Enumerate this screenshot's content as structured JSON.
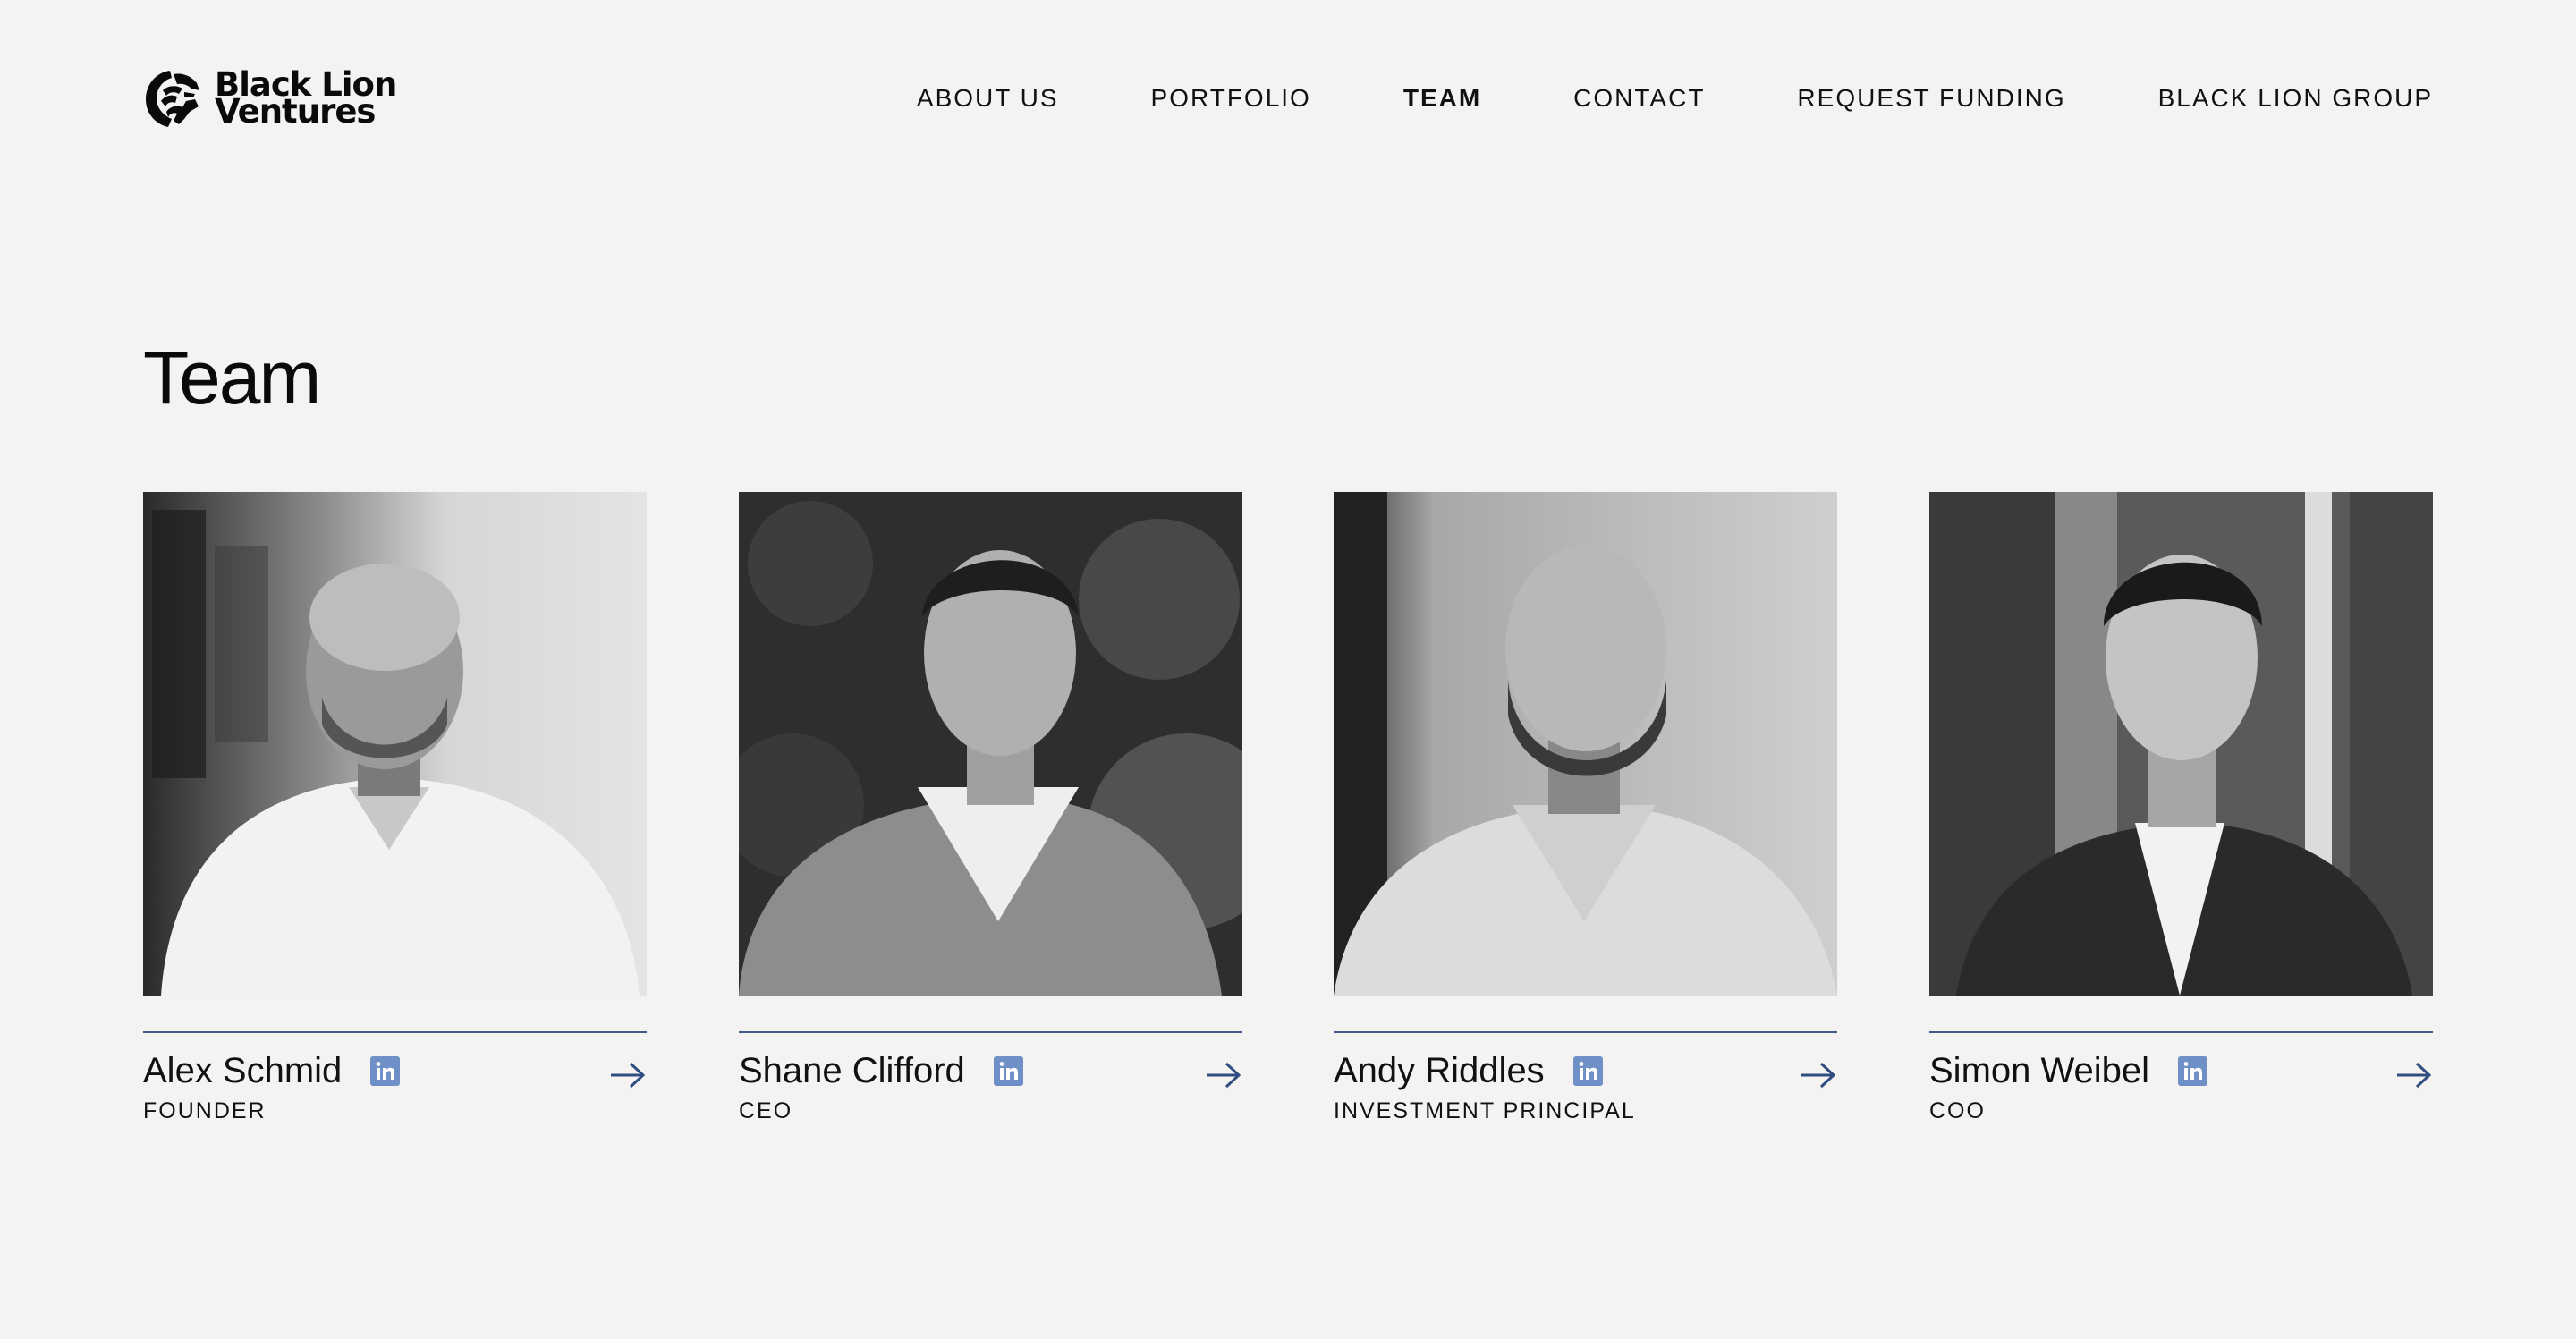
{
  "brand": {
    "name_line1": "Black Lion",
    "name_line2": "Ventures"
  },
  "nav": {
    "items": [
      {
        "label": "ABOUT US",
        "active": false
      },
      {
        "label": "PORTFOLIO",
        "active": false
      },
      {
        "label": "TEAM",
        "active": true
      },
      {
        "label": "CONTACT",
        "active": false
      },
      {
        "label": "REQUEST FUNDING",
        "active": false
      },
      {
        "label": "BLACK LION GROUP",
        "active": false
      }
    ]
  },
  "page": {
    "title": "Team"
  },
  "team": {
    "members": [
      {
        "name": "Alex Schmid",
        "role": "FOUNDER"
      },
      {
        "name": "Shane Clifford",
        "role": "CEO"
      },
      {
        "name": "Andy Riddles",
        "role": "INVESTMENT PRINCIPAL"
      },
      {
        "name": "Simon Weibel",
        "role": "COO"
      }
    ]
  },
  "colors": {
    "background": "#f4f3f2",
    "accent": "#3e5b8c",
    "linkedin": "#6f8fc7",
    "text": "#111111"
  },
  "icons": {
    "social": "linkedin-icon",
    "more": "arrow-right-icon",
    "logo": "lion-head-logo"
  }
}
